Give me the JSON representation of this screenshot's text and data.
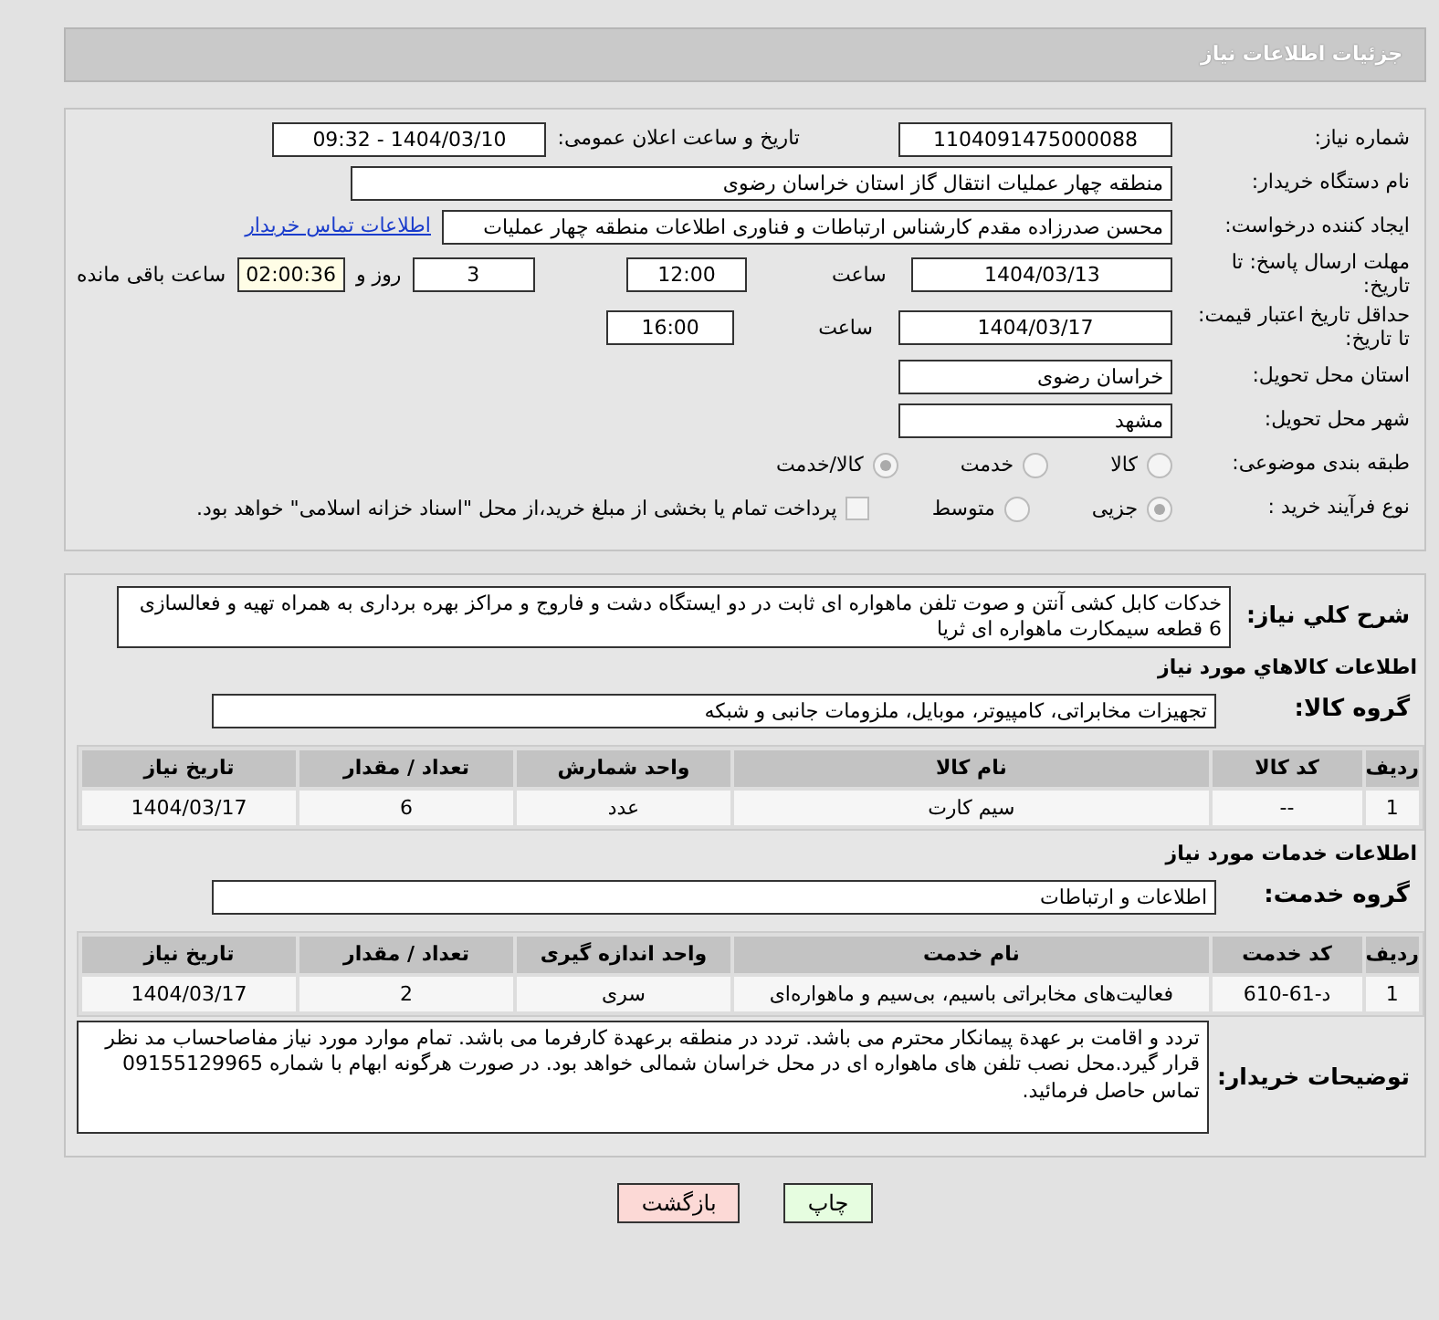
{
  "header": {
    "title": "جزئیات اطلاعات نیاز"
  },
  "need_number": {
    "label": "شماره نیاز:",
    "value": "1104091475000088"
  },
  "announce": {
    "label": "تاریخ و ساعت اعلان عمومی:",
    "value": "1404/03/10 - 09:32"
  },
  "buyer_org": {
    "label": "نام دستگاه خریدار:",
    "value": "منطقه چهار عملیات انتقال گاز   استان خراسان رضوی"
  },
  "requester": {
    "label": "ایجاد کننده درخواست:",
    "value": "محسن صدرزاده مقدم کارشناس ارتباطات و فناوری اطلاعات منطقه چهار عملیات",
    "link": "اطلاعات تماس خریدار"
  },
  "reply_deadline": {
    "label": "مهلت ارسال پاسخ: تا تاریخ:",
    "date": "1404/03/13",
    "time_label": "ساعت",
    "time": "12:00",
    "days": "3",
    "days_label": "روز و",
    "remaining": "02:00:36",
    "remaining_label": "ساعت باقی مانده"
  },
  "price_validity": {
    "label": "حداقل تاریخ اعتبار قیمت: تا تاریخ:",
    "date": "1404/03/17",
    "time_label": "ساعت",
    "time": "16:00"
  },
  "province": {
    "label": "استان محل تحویل:",
    "value": "خراسان رضوی"
  },
  "city": {
    "label": "شهر محل تحویل:",
    "value": "مشهد"
  },
  "category": {
    "label": "طبقه بندی موضوعی:",
    "options": [
      {
        "label": "کالا",
        "selected": false
      },
      {
        "label": "خدمت",
        "selected": false
      },
      {
        "label": "کالا/خدمت",
        "selected": true
      }
    ]
  },
  "process": {
    "label": "نوع فرآیند خرید :",
    "options": [
      {
        "label": "جزیی",
        "selected": true
      },
      {
        "label": "متوسط",
        "selected": false
      }
    ],
    "payment": {
      "label": "پرداخت تمام یا بخشی از مبلغ خرید،از محل \"اسناد خزانه اسلامی\" خواهد بود.",
      "checked": false
    }
  },
  "description": {
    "label": "شرح کلي نياز:",
    "value": "خدکات کابل کشی آنتن و صوت تلفن ماهواره ای ثابت در دو ایستگاه دشت و فاروج و مراکز بهره برداری به همراه تهیه و فعالسازی 6 قطعه سیمکارت ماهواره ای ثریا"
  },
  "goods": {
    "title": "اطلاعات کالاهاي مورد نياز",
    "group_label": "گروه کالا:",
    "group_value": "تجهیزات مخابراتی، کامپیوتر، موبایل، ملزومات جانبی و شبکه",
    "columns": [
      "ردیف",
      "کد کالا",
      "نام کالا",
      "واحد شمارش",
      "تعداد / مقدار",
      "تاریخ نیاز"
    ],
    "rows": [
      [
        "1",
        "--",
        "سیم کارت",
        "عدد",
        "6",
        "1404/03/17"
      ]
    ]
  },
  "services": {
    "title": "اطلاعات خدمات مورد نیاز",
    "group_label": "گروه خدمت:",
    "group_value": "اطلاعات و ارتباطات",
    "columns": [
      "ردیف",
      "کد خدمت",
      "نام خدمت",
      "واحد اندازه گیری",
      "تعداد / مقدار",
      "تاریخ نیاز"
    ],
    "rows": [
      [
        "1",
        "د-61-610",
        "فعالیت‌های مخابراتی باسیم، بی‌سیم و ماهواره‌ای",
        "سری",
        "2",
        "1404/03/17"
      ]
    ]
  },
  "buyer_notes": {
    "label": "توضیحات خریدار:",
    "value": "تردد و اقامت بر عهدة پیمانکار محترم می باشد. تردد در منطقه برعهدة کارفرما می باشد. تمام موارد مورد نیاز مفاصاحساب مد نظر قرار گیرد.محل نصب تلفن های ماهواره ای در محل خراسان شمالی خواهد بود. در صورت هرگونه ابهام با شماره 09155129965 تماس حاصل فرمائید."
  },
  "buttons": [
    {
      "label": "چاپ",
      "kind": "print"
    },
    {
      "label": "بازگشت",
      "kind": "back"
    }
  ]
}
